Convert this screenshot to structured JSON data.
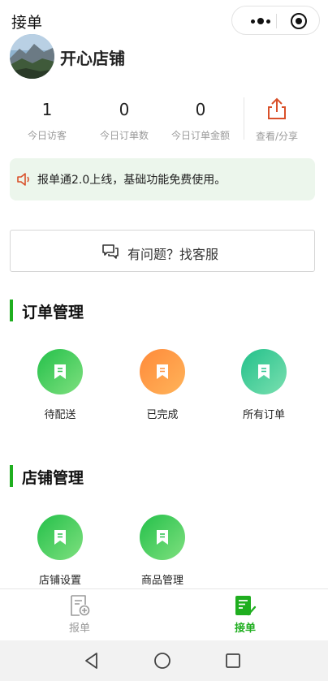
{
  "header": {
    "title": "接单"
  },
  "shop": {
    "name": "开心店铺"
  },
  "stats": [
    {
      "value": "1",
      "label": "今日访客"
    },
    {
      "value": "0",
      "label": "今日订单数"
    },
    {
      "value": "0",
      "label": "今日订单金额"
    }
  ],
  "share": {
    "label": "查看/分享"
  },
  "notice": {
    "text": "报单通2.0上线，基础功能免费使用。"
  },
  "service": {
    "label": "有问题？找客服"
  },
  "orders_section": {
    "title": "订单管理",
    "items": [
      {
        "label": "待配送",
        "icon": "bookmark-icon"
      },
      {
        "label": "已完成",
        "icon": "bookmark-icon"
      },
      {
        "label": "所有订单",
        "icon": "bookmark-icon"
      }
    ]
  },
  "shop_section": {
    "title": "店铺管理",
    "items": [
      {
        "label": "店铺设置",
        "icon": "bookmark-icon"
      },
      {
        "label": "商品管理",
        "icon": "bookmark-icon"
      }
    ]
  },
  "tabbar": {
    "items": [
      {
        "label": "报单",
        "icon": "document-add-icon",
        "active": false
      },
      {
        "label": "接单",
        "icon": "document-check-icon",
        "active": true
      }
    ]
  },
  "colors": {
    "accent": "#1fae1f",
    "notice_bg": "#ecf6ec",
    "share_icon": "#d9502a",
    "orange": "#ff8a3a"
  }
}
